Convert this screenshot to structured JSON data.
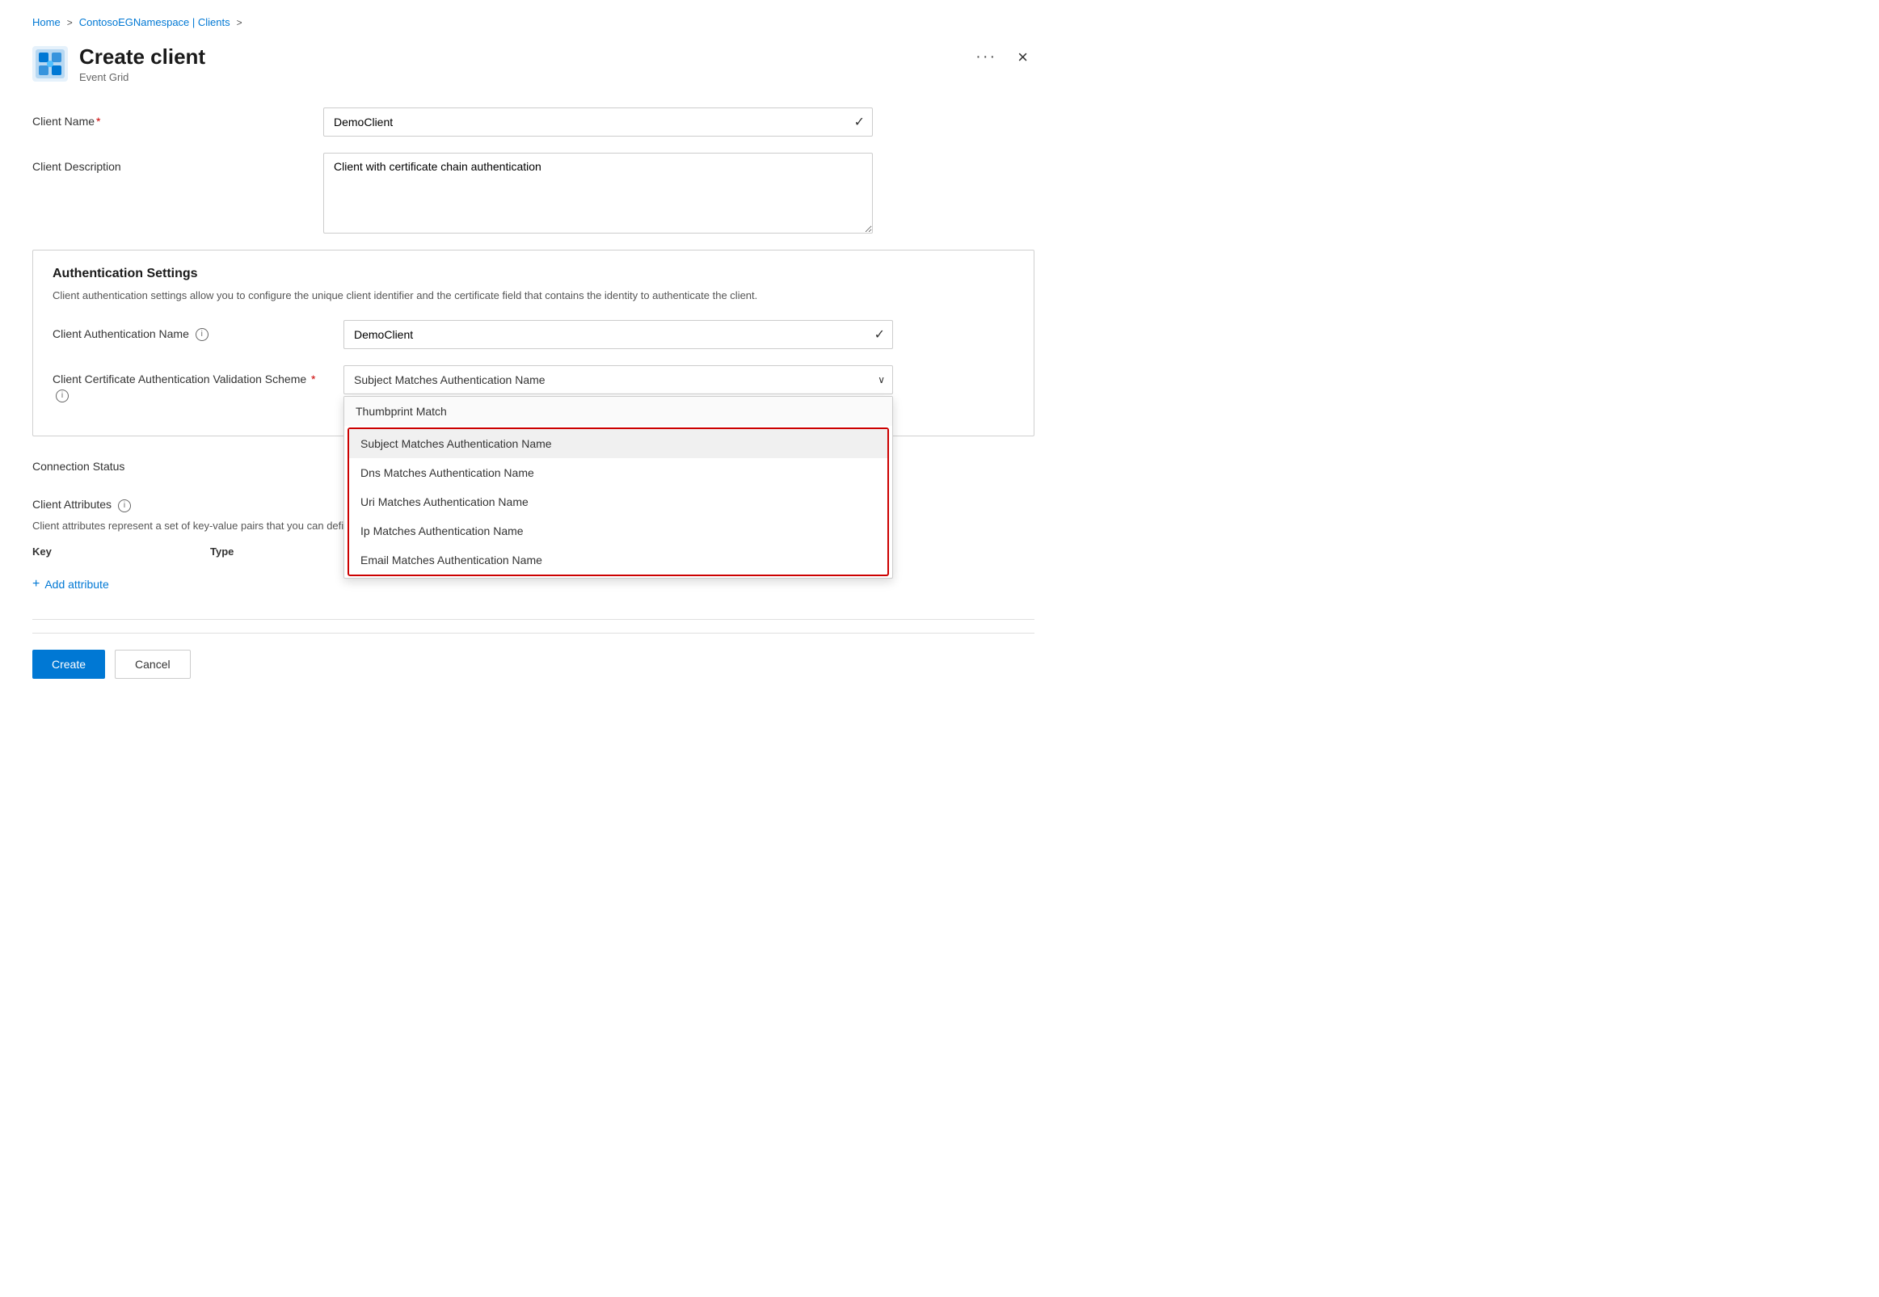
{
  "breadcrumb": {
    "home": "Home",
    "namespace": "ContosoEGNamespace | Clients",
    "separator": ">"
  },
  "header": {
    "title": "Create client",
    "subtitle": "Event Grid",
    "dots_label": "···",
    "close_label": "×"
  },
  "form": {
    "client_name_label": "Client Name",
    "client_name_required": "*",
    "client_name_value": "DemoClient",
    "client_description_label": "Client Description",
    "client_description_value": "Client with certificate chain authentication"
  },
  "auth_settings": {
    "title": "Authentication Settings",
    "description": "Client authentication settings allow you to configure the unique client identifier and the certificate field that contains the identity to authenticate the client.",
    "auth_name_label": "Client Authentication Name",
    "auth_name_value": "DemoClient",
    "validation_label": "Client Certificate Authentication Validation Scheme",
    "validation_required": "*",
    "validation_selected": "Subject Matches Authentication Name",
    "dropdown_options": [
      {
        "value": "thumbprint",
        "label": "Thumbprint Match",
        "group": "none"
      },
      {
        "value": "subject",
        "label": "Subject Matches Authentication Name",
        "group": "highlighted",
        "selected": true
      },
      {
        "value": "dns",
        "label": "Dns Matches Authentication Name",
        "group": "highlighted"
      },
      {
        "value": "uri",
        "label": "Uri Matches Authentication Name",
        "group": "highlighted"
      },
      {
        "value": "ip",
        "label": "Ip Matches Authentication Name",
        "group": "highlighted"
      },
      {
        "value": "email",
        "label": "Email Matches Authentication Name",
        "group": "highlighted"
      }
    ]
  },
  "connection_status": {
    "label": "Connection Status",
    "value": ""
  },
  "client_attributes": {
    "label": "Client Attributes",
    "description": "Client attributes represent a set of key-value pairs that you can define to filter and route events based on common attribute values.",
    "key_col": "Key",
    "type_col": "Type",
    "add_attribute_label": "+ Add attribute"
  },
  "footer": {
    "create_label": "Create",
    "cancel_label": "Cancel"
  }
}
